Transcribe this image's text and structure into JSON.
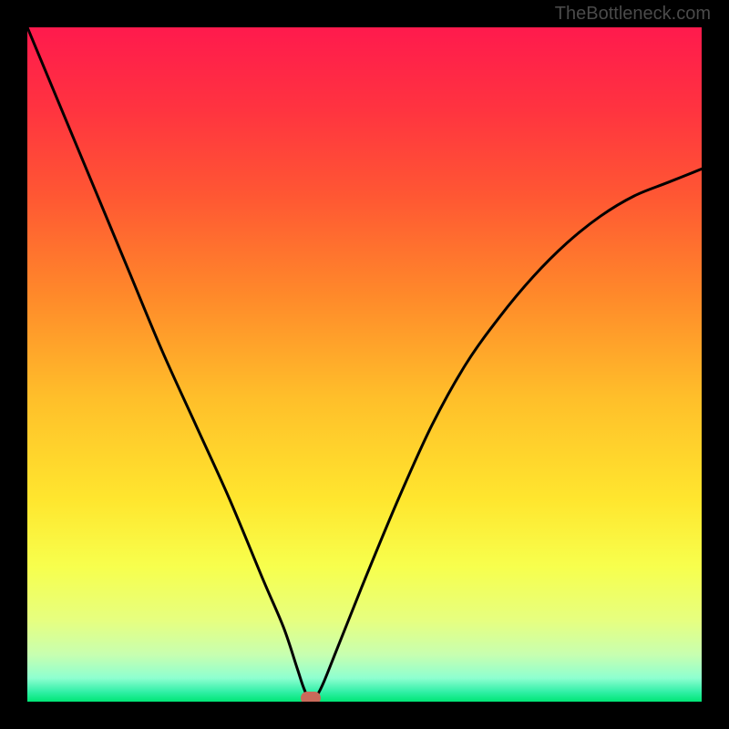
{
  "watermark": "TheBottleneck.com",
  "chart_data": {
    "type": "line",
    "title": "",
    "xlabel": "",
    "ylabel": "",
    "xlim": [
      0,
      100
    ],
    "ylim": [
      0,
      100
    ],
    "notes": "Gradient background chart with a V-shaped bottleneck curve. Minimum near x≈42 at y≈0. No axes/ticks visible.",
    "series": [
      {
        "name": "bottleneck-curve",
        "x": [
          0,
          5,
          10,
          15,
          20,
          25,
          30,
          35,
          38,
          40,
          41,
          42,
          43,
          44,
          46,
          50,
          55,
          60,
          65,
          70,
          75,
          80,
          85,
          90,
          95,
          100
        ],
        "values": [
          100,
          88,
          76,
          64,
          52,
          41,
          30,
          18,
          11,
          5,
          2,
          0,
          1,
          3,
          8,
          18,
          30,
          41,
          50,
          57,
          63,
          68,
          72,
          75,
          77,
          79
        ]
      }
    ],
    "marker": {
      "x": 42,
      "y": 0,
      "color": "#c96a5a"
    },
    "gradient_stops": [
      {
        "offset": 0.0,
        "color": "#ff1a4d"
      },
      {
        "offset": 0.12,
        "color": "#ff3340"
      },
      {
        "offset": 0.25,
        "color": "#ff5733"
      },
      {
        "offset": 0.4,
        "color": "#ff8a2a"
      },
      {
        "offset": 0.55,
        "color": "#ffbf2a"
      },
      {
        "offset": 0.7,
        "color": "#ffe62e"
      },
      {
        "offset": 0.8,
        "color": "#f7ff4d"
      },
      {
        "offset": 0.88,
        "color": "#e6ff80"
      },
      {
        "offset": 0.93,
        "color": "#c8ffb0"
      },
      {
        "offset": 0.965,
        "color": "#8effd0"
      },
      {
        "offset": 0.985,
        "color": "#33f0a8"
      },
      {
        "offset": 1.0,
        "color": "#00e676"
      }
    ]
  }
}
